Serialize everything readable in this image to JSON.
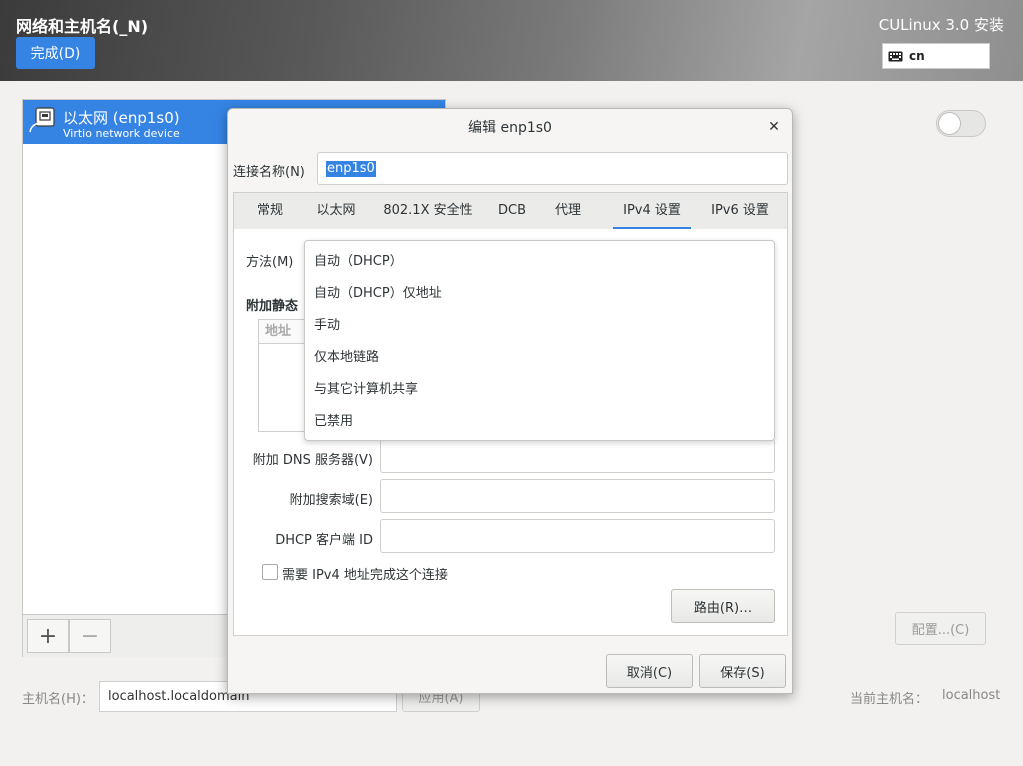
{
  "header": {
    "title": "网络和主机名(_N)",
    "done_label": "完成(D)",
    "product": "CULinux 3.0 安装",
    "keyboard_layout": "cn"
  },
  "devices": [
    {
      "name": "以太网 (enp1s0)",
      "subtitle": "Virtio network device",
      "selected": true
    }
  ],
  "list_toolbar": {
    "add_label": "+",
    "remove_label": "−"
  },
  "device_toggle": {
    "on": false
  },
  "configure_label": "配置...(C)",
  "hostname": {
    "label": "主机名(H)：",
    "value": "localhost.localdomain",
    "apply_label": "应用(A)",
    "current_label": "当前主机名：",
    "current_value": "localhost"
  },
  "dialog": {
    "title": "编辑 enp1s0",
    "close_icon": "close-icon",
    "connection_name_label": "连接名称(N)",
    "connection_name_value": "enp1s0",
    "tabs": [
      "常规",
      "以太网",
      "802.1X 安全性",
      "DCB",
      "代理",
      "IPv4 设置",
      "IPv6 设置"
    ],
    "active_tab": "IPv4 设置",
    "method_label": "方法(M)",
    "static_label": "附加静态",
    "address_header": "地址",
    "method_options": [
      "自动（DHCP）",
      "自动（DHCP）仅地址",
      "手动",
      "仅本地链路",
      "与其它计算机共享",
      "已禁用"
    ],
    "dns_label": "附加 DNS 服务器(V)",
    "search_label": "附加搜索域(E)",
    "dhcp_label": "DHCP 客户端 ID",
    "require_label": "需要 IPv4 地址完成这个连接",
    "require_checked": false,
    "routes_label": "路由(R)…",
    "cancel_label": "取消(C)",
    "save_label": "保存(S)"
  },
  "colors": {
    "accent": "#3584e4"
  }
}
